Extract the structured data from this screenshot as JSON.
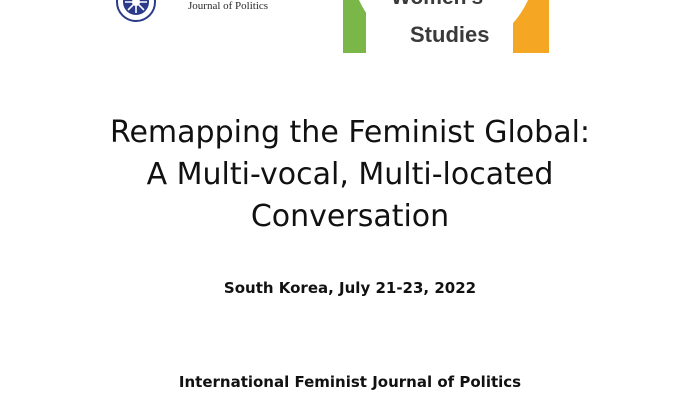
{
  "header": {
    "left_logo": {
      "text": "Journal of Politics",
      "icon": "journal-seal-icon",
      "color": "#2b3a8a"
    },
    "right_logo": {
      "line1": "Women's",
      "line2": "Studies",
      "colors": {
        "green": "#7ab648",
        "orange": "#f5a623"
      }
    }
  },
  "title": {
    "line1": "Remapping the Feminist Global:",
    "line2": "A Multi-vocal, Multi-located",
    "line3": "Conversation"
  },
  "event": {
    "location_date": "South Korea, July 21-23, 2022"
  },
  "organizer": {
    "name": "International Feminist Journal of Politics"
  }
}
